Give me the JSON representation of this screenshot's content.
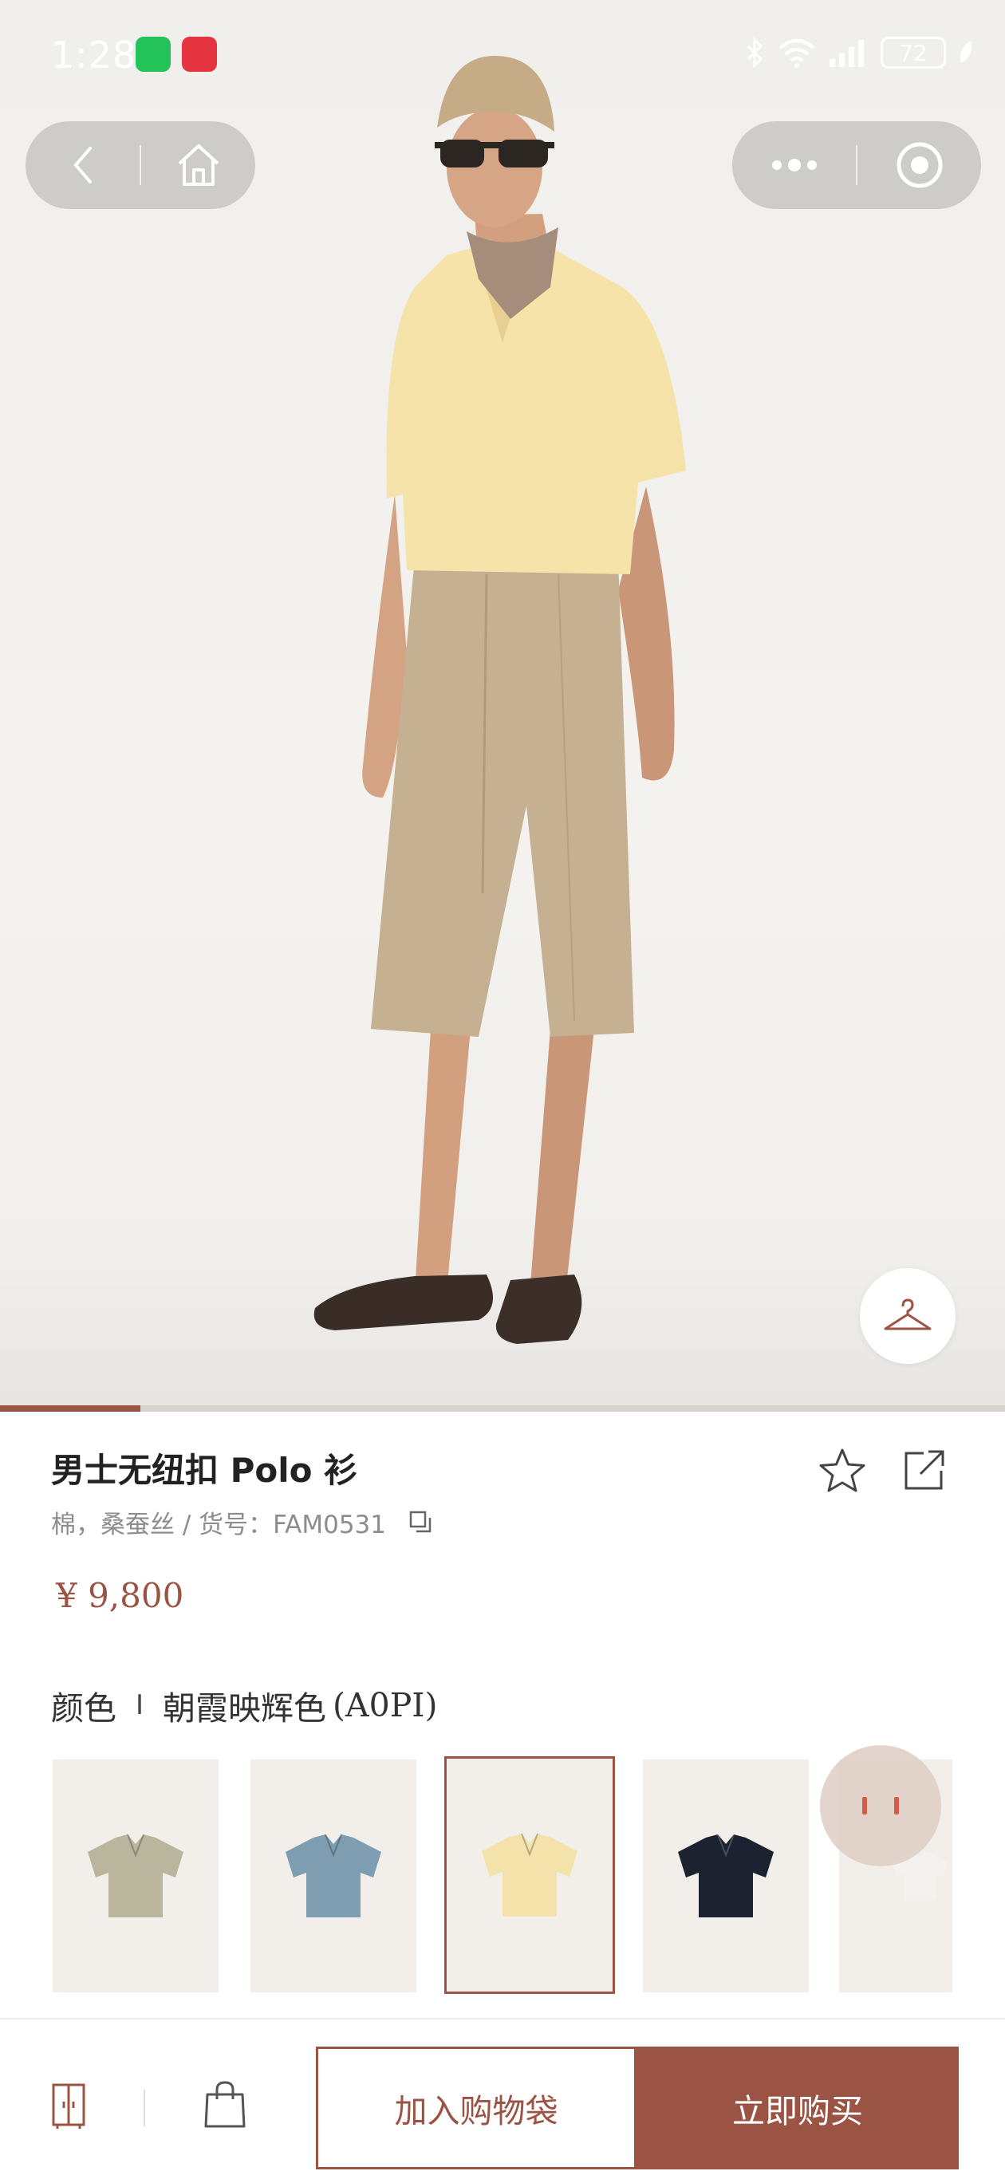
{
  "status_bar": {
    "time": "1:28",
    "battery": "72"
  },
  "product": {
    "title": "男士无纽扣 Polo 衫",
    "meta": "棉，桑蚕丝 / 货号：FAM0531",
    "price": "¥ 9,800"
  },
  "color": {
    "label": "颜色",
    "separator": "I",
    "selected_name": "朝霞映辉色",
    "selected_code": "(A0PI)"
  },
  "swatches": [
    {
      "color": "#b9b69d"
    },
    {
      "color": "#7f9db0"
    },
    {
      "color": "#f3e2a9"
    },
    {
      "color": "#1c2230"
    },
    {
      "color": "#f4f2ee"
    }
  ],
  "gallery": {
    "progress_fraction": 0.14
  },
  "actions": {
    "add_to_bag": "加入购物袋",
    "buy_now": "立即购买"
  },
  "colors": {
    "accent": "#9b5444"
  }
}
